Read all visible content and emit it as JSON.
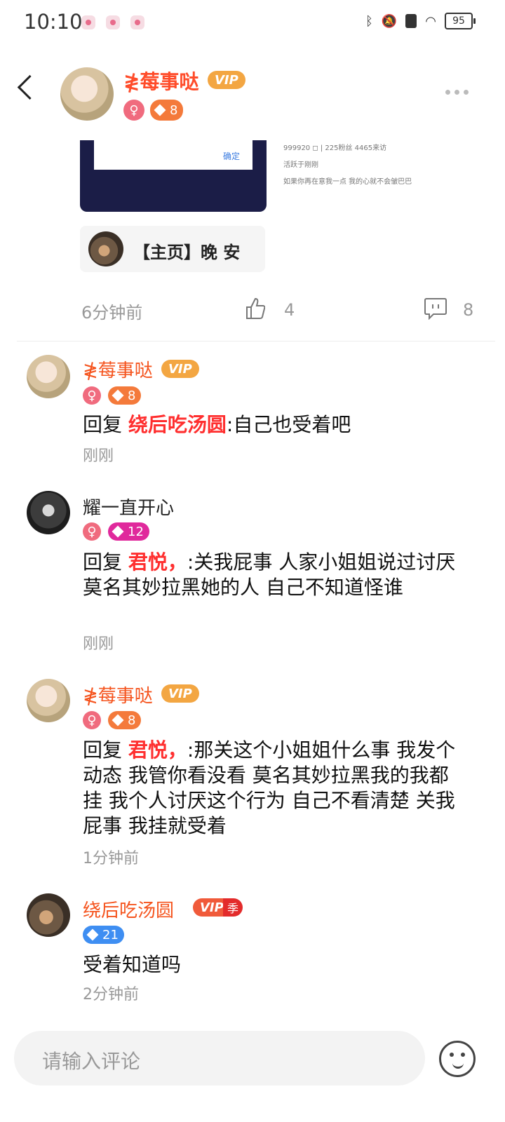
{
  "status_bar": {
    "time": "10:10",
    "battery": "95"
  },
  "header": {
    "user_name": "≹莓事哒",
    "vip_label": "VIP",
    "gender": "♀",
    "level": "8"
  },
  "post": {
    "image_confirm_label": "确定",
    "meta_line1": "999920 ◻ | 225粉丝 4465来访",
    "meta_line2": "活跃于刚刚",
    "meta_line3": "如果你再在意我一点 我的心就不会皱巴巴",
    "link_title": "【主页】晚 安",
    "time": "6分钟前",
    "likes": "4",
    "comments": "8"
  },
  "comments": [
    {
      "name": "≹莓事哒",
      "vip": "VIP",
      "gender": "♀",
      "level": "8",
      "reply_prefix": "回复 ",
      "reply_to": "绕后吃汤圆",
      "text": ":自己也受着吧",
      "time": "刚刚"
    },
    {
      "name": "耀一直开心",
      "gender": "♀",
      "level": "12",
      "reply_prefix": "回复 ",
      "reply_to": "君悦，",
      "text": ":关我屁事 人家小姐姐说过讨厌莫名其妙拉黑她的人 自己不知道怪谁",
      "time": "刚刚"
    },
    {
      "name": "≹莓事哒",
      "vip": "VIP",
      "gender": "♀",
      "level": "8",
      "reply_prefix": "回复 ",
      "reply_to": "君悦，",
      "text": ":那关这个小姐姐什么事 我发个动态 我管你看没看 莫名其妙拉黑我的我都挂 我个人讨厌这个行为 自己不看清楚 关我屁事 我挂就受着",
      "time": "1分钟前"
    },
    {
      "name": "绕后吃汤圆",
      "vip": "VIP",
      "season": "季",
      "level": "21",
      "text": "受着知道吗",
      "time": "2分钟前"
    }
  ],
  "input": {
    "placeholder": "请输入评论"
  },
  "icons": {
    "back": "back-arrow-icon",
    "more": "more-dots-icon",
    "like": "thumbs-up-icon",
    "comment": "comment-bubble-icon",
    "emoji": "emoji-icon"
  }
}
